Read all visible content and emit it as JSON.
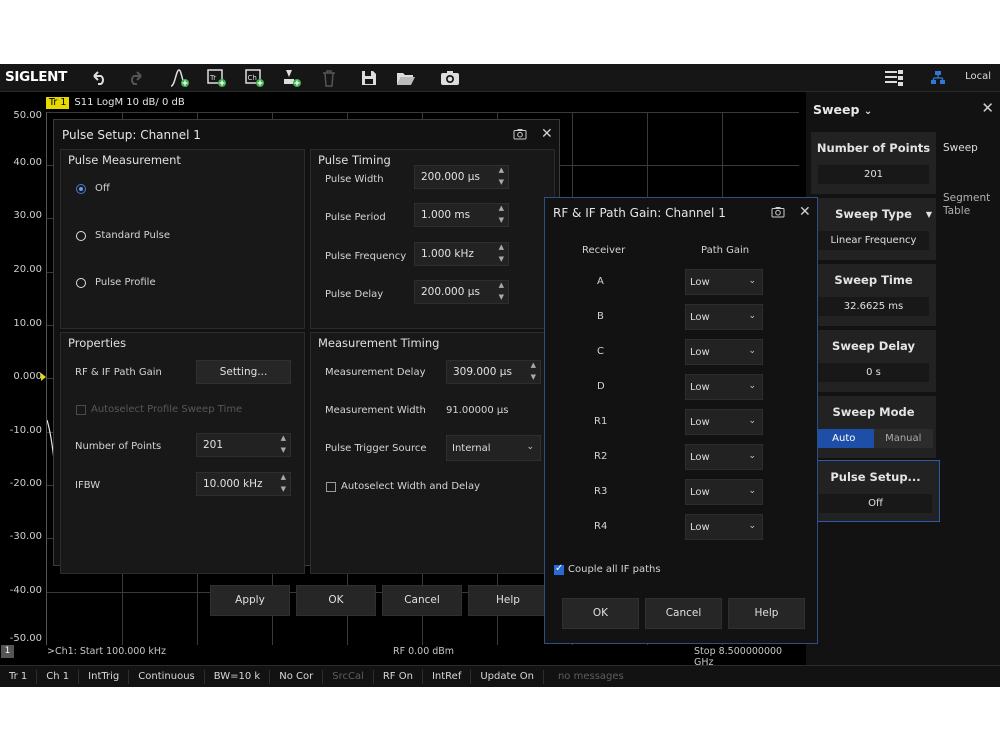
{
  "toolbar": {
    "logo": "SIGLENT",
    "local": "Local"
  },
  "trace_header": {
    "tag": "Tr 1",
    "text": "S11  LogM  10 dB/  0 dB"
  },
  "y_axis": [
    "50.00",
    "40.00",
    "30.00",
    "20.00",
    "10.00",
    "0.000",
    "-10.00",
    "-20.00",
    "-30.00",
    "-40.00",
    "-50.00"
  ],
  "plot_footer": {
    "channel_num": "1",
    "start": ">Ch1: Start 100.000 kHz",
    "power": "RF 0.00 dBm",
    "stop": "Stop 8.500000000 GHz"
  },
  "statusbar": [
    "Tr 1",
    "Ch 1",
    "IntTrig",
    "Continuous",
    "BW=10 k",
    "No Cor",
    "SrcCal",
    "RF On",
    "IntRef",
    "Update On",
    "no messages"
  ],
  "right_panel": {
    "title": "Sweep",
    "chevron": "⌄",
    "close": "✕",
    "side_items": [
      "Sweep",
      "Segment\nTable"
    ],
    "number_of_points": {
      "label": "Number of Points",
      "value": "201"
    },
    "sweep_type": {
      "label": "Sweep Type",
      "value": "Linear Frequency"
    },
    "sweep_time": {
      "label": "Sweep Time",
      "value": "32.6625 ms"
    },
    "sweep_delay": {
      "label": "Sweep Delay",
      "value": "0 s"
    },
    "sweep_mode": {
      "label": "Sweep Mode",
      "auto": "Auto",
      "manual": "Manual"
    },
    "pulse_setup": {
      "label": "Pulse Setup...",
      "value": "Off"
    }
  },
  "pulse_dialog": {
    "title": "Pulse Setup: Channel 1",
    "measurement": {
      "title": "Pulse Measurement",
      "off": "Off",
      "standard": "Standard Pulse",
      "profile": "Pulse Profile"
    },
    "timing": {
      "title": "Pulse Timing",
      "width_label": "Pulse Width",
      "width": "200.000 µs",
      "period_label": "Pulse Period",
      "period": "1.000 ms",
      "freq_label": "Pulse Frequency",
      "freq": "1.000 kHz",
      "delay_label": "Pulse Delay",
      "delay": "200.000 µs"
    },
    "properties": {
      "title": "Properties",
      "rf_if_label": "RF & IF Path Gain",
      "setting_btn": "Setting...",
      "autoselect_profile": "Autoselect Profile Sweep Time",
      "points_label": "Number of Points",
      "points": "201",
      "ifbw_label": "IFBW",
      "ifbw": "10.000 kHz"
    },
    "meas_timing": {
      "title": "Measurement Timing",
      "delay_label": "Measurement Delay",
      "delay": "309.000 µs",
      "width_label": "Measurement Width",
      "width": "91.00000 µs",
      "trigger_label": "Pulse Trigger Source",
      "trigger": "Internal",
      "autoselect": "Autoselect Width and Delay"
    },
    "buttons": {
      "apply": "Apply",
      "ok": "OK",
      "cancel": "Cancel",
      "help": "Help"
    }
  },
  "gain_dialog": {
    "title": "RF & IF Path Gain: Channel 1",
    "col_receiver": "Receiver",
    "col_gain": "Path Gain",
    "rows": [
      {
        "receiver": "A",
        "gain": "Low"
      },
      {
        "receiver": "B",
        "gain": "Low"
      },
      {
        "receiver": "C",
        "gain": "Low"
      },
      {
        "receiver": "D",
        "gain": "Low"
      },
      {
        "receiver": "R1",
        "gain": "Low"
      },
      {
        "receiver": "R2",
        "gain": "Low"
      },
      {
        "receiver": "R3",
        "gain": "Low"
      },
      {
        "receiver": "R4",
        "gain": "Low"
      }
    ],
    "couple": "Couple all IF paths",
    "buttons": {
      "ok": "OK",
      "cancel": "Cancel",
      "help": "Help"
    }
  },
  "colors": {
    "accent_blue": "#2b6ad6",
    "trace_yellow": "#e7d800",
    "background": "#000000",
    "panel": "#121212"
  }
}
